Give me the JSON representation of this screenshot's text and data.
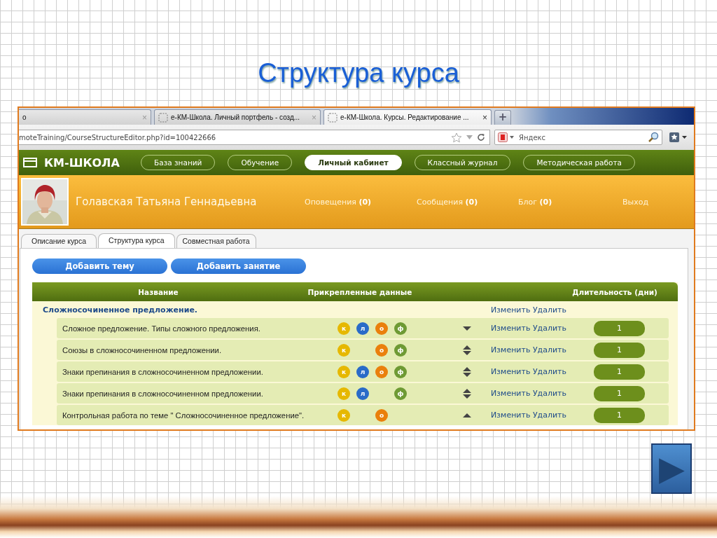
{
  "slide": {
    "title": "Структура курса",
    "next_button": {
      "label": "▶"
    }
  },
  "browser": {
    "tabs": [
      {
        "label": "о",
        "close": "×",
        "selected": false
      },
      {
        "label": "е-КМ-Школа. Личный портфель - созд...",
        "close": "×",
        "selected": false
      },
      {
        "label": "е-КМ-Школа. Курсы. Редактирование ...",
        "close": "×",
        "selected": true
      }
    ],
    "new_tab": "+",
    "address": "moteTraining/CourseStructureEditor.php?id=100422666",
    "search_placeholder": "Яндекс"
  },
  "site": {
    "logo": "КМ-ШКОЛА",
    "nav": [
      {
        "label": "База знаний",
        "selected": false
      },
      {
        "label": "Обучение",
        "selected": false
      },
      {
        "label": "Личный кабинет",
        "selected": true
      },
      {
        "label": "Классный журнал",
        "selected": false
      },
      {
        "label": "Методическая работа",
        "selected": false
      }
    ]
  },
  "user": {
    "name": "Голавская Татьяна Геннадьевна",
    "links": [
      {
        "label": "Оповещения",
        "count": "(0)"
      },
      {
        "label": "Сообщения",
        "count": "(0)"
      },
      {
        "label": "Блог",
        "count": "(0)"
      },
      {
        "label": "Выход"
      }
    ]
  },
  "page_tabs": [
    {
      "label": "Описание курса",
      "selected": false
    },
    {
      "label": "Структура курса",
      "selected": true
    },
    {
      "label": "Совместная работа",
      "selected": false
    }
  ],
  "actions": [
    "Добавить тему",
    "Добавить занятие"
  ],
  "table": {
    "columns": [
      "Название",
      "Прикрепленные данные",
      "Длительность (дни)"
    ],
    "topic": {
      "title": "Сложносочиненное предложение.",
      "edit": "Изменить",
      "delete": "Удалить"
    },
    "rows": [
      {
        "title": "Сложное предложение. Типы сложного предложения.",
        "attachments": [
          {
            "kind": "k",
            "label": "к",
            "color": "#e6b800"
          },
          {
            "kind": "l",
            "label": "л",
            "color": "#2a6bc8"
          },
          {
            "kind": "o",
            "label": "о",
            "color": "#ea800c"
          },
          {
            "kind": "f",
            "label": "ф",
            "color": "#6e9a34"
          }
        ],
        "kind": "first",
        "edit": "Изменить",
        "delete": "Удалить",
        "duration": "1"
      },
      {
        "title": "Союзы в сложносочиненном предложении.",
        "attachments": [
          {
            "kind": "k",
            "label": "к",
            "color": "#e6b800"
          },
          {
            "kind": "o",
            "label": "о",
            "color": "#ea800c"
          },
          {
            "kind": "f",
            "label": "ф",
            "color": "#6e9a34"
          }
        ],
        "kind": "middle",
        "edit": "Изменить",
        "delete": "Удалить",
        "duration": "1"
      },
      {
        "title": "Знаки препинания в сложносочиненном предложении.",
        "attachments": [
          {
            "kind": "k",
            "label": "к",
            "color": "#e6b800"
          },
          {
            "kind": "l",
            "label": "л",
            "color": "#2a6bc8"
          },
          {
            "kind": "o",
            "label": "о",
            "color": "#ea800c"
          },
          {
            "kind": "f",
            "label": "ф",
            "color": "#6e9a34"
          }
        ],
        "kind": "middle",
        "edit": "Изменить",
        "delete": "Удалить",
        "duration": "1"
      },
      {
        "title": "Знаки препинания в сложносочиненном предложении.",
        "attachments": [
          {
            "kind": "k",
            "label": "к",
            "color": "#e6b800"
          },
          {
            "kind": "l",
            "label": "л",
            "color": "#2a6bc8"
          },
          {
            "kind": "f",
            "label": "ф",
            "color": "#6e9a34"
          }
        ],
        "kind": "middle",
        "edit": "Изменить",
        "delete": "Удалить",
        "duration": "1"
      },
      {
        "title": "Контрольная работа по теме \" Сложносочиненное предложение\".",
        "attachments": [
          {
            "kind": "k",
            "label": "к",
            "color": "#e6b800"
          },
          {
            "kind": "o",
            "label": "о",
            "color": "#ea800c"
          }
        ],
        "kind": "last",
        "edit": "Изменить",
        "delete": "Удалить",
        "duration": "1"
      }
    ]
  }
}
